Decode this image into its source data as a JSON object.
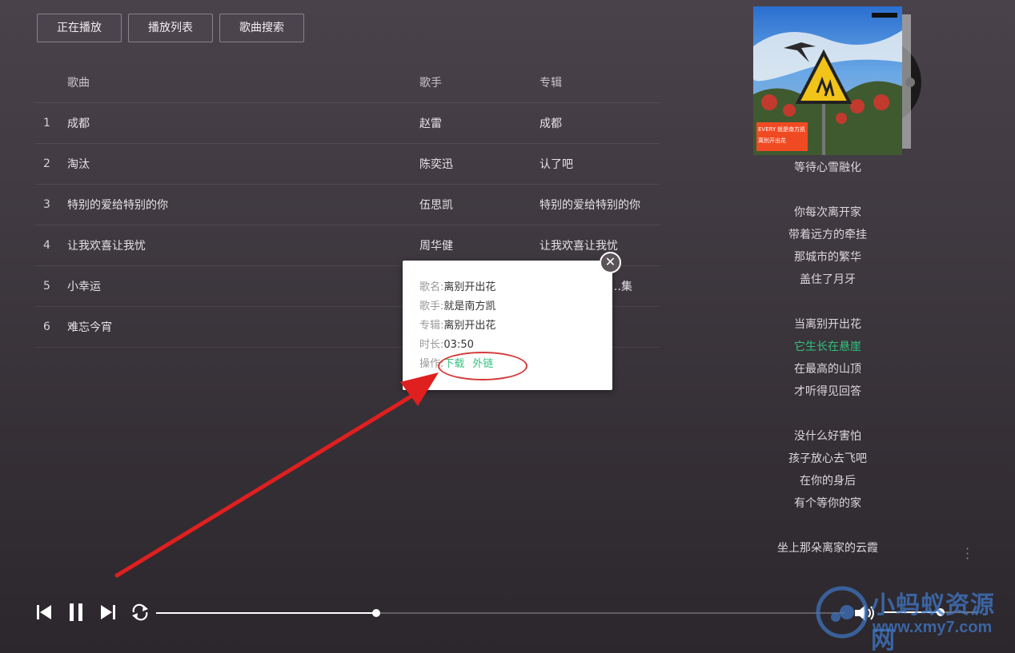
{
  "tabs": [
    "正在播放",
    "播放列表",
    "歌曲搜索"
  ],
  "table": {
    "headers": {
      "name": "歌曲",
      "singer": "歌手",
      "album": "专辑"
    },
    "rows": [
      {
        "idx": "1",
        "name": "成都",
        "singer": "赵雷",
        "album": "成都"
      },
      {
        "idx": "2",
        "name": "淘汰",
        "singer": "陈奕迅",
        "album": "认了吧"
      },
      {
        "idx": "3",
        "name": "特别的爱给特别的你",
        "singer": "伍思凯",
        "album": "特别的爱给特别的你"
      },
      {
        "idx": "4",
        "name": "让我欢喜让我忧",
        "singer": "周华健",
        "album": "让我欢喜让我忧"
      },
      {
        "idx": "5",
        "name": "小幸运",
        "singer": "",
        "album": "…集"
      },
      {
        "idx": "6",
        "name": "难忘今宵",
        "singer": "",
        "album": ""
      }
    ]
  },
  "popup": {
    "name_label": "歌名:",
    "name_value": "离别开出花",
    "singer_label": "歌手:",
    "singer_value": "就是南方凯",
    "album_label": "专辑:",
    "album_value": "离别开出花",
    "duration_label": "时长:",
    "duration_value": "03:50",
    "action_label": "操作:",
    "download": "下载",
    "external_link": "外链",
    "close_glyph": "✕"
  },
  "album_art_text": [
    "EVERY",
    "就是南方凯",
    "离别开出花"
  ],
  "lyrics": {
    "lines": [
      "等待心雪融化",
      "",
      "你每次离开家",
      "带着远方的牵挂",
      "那城市的繁华",
      "盖住了月牙",
      "",
      "当离别开出花",
      "它生长在悬崖",
      "在最高的山顶",
      "才听得见回答",
      "",
      "没什么好害怕",
      "孩子放心去飞吧",
      "在你的身后",
      "有个等你的家",
      "",
      "坐上那朵离家的云霞"
    ],
    "active_index": 8
  },
  "player": {
    "progress": 0.32,
    "volume": 0.6
  },
  "watermark": {
    "title": "小蚂蚁资源网",
    "url": "www.xmy7.com"
  },
  "colors": {
    "accent": "#31c27c",
    "annotation": "#d43a3a"
  }
}
